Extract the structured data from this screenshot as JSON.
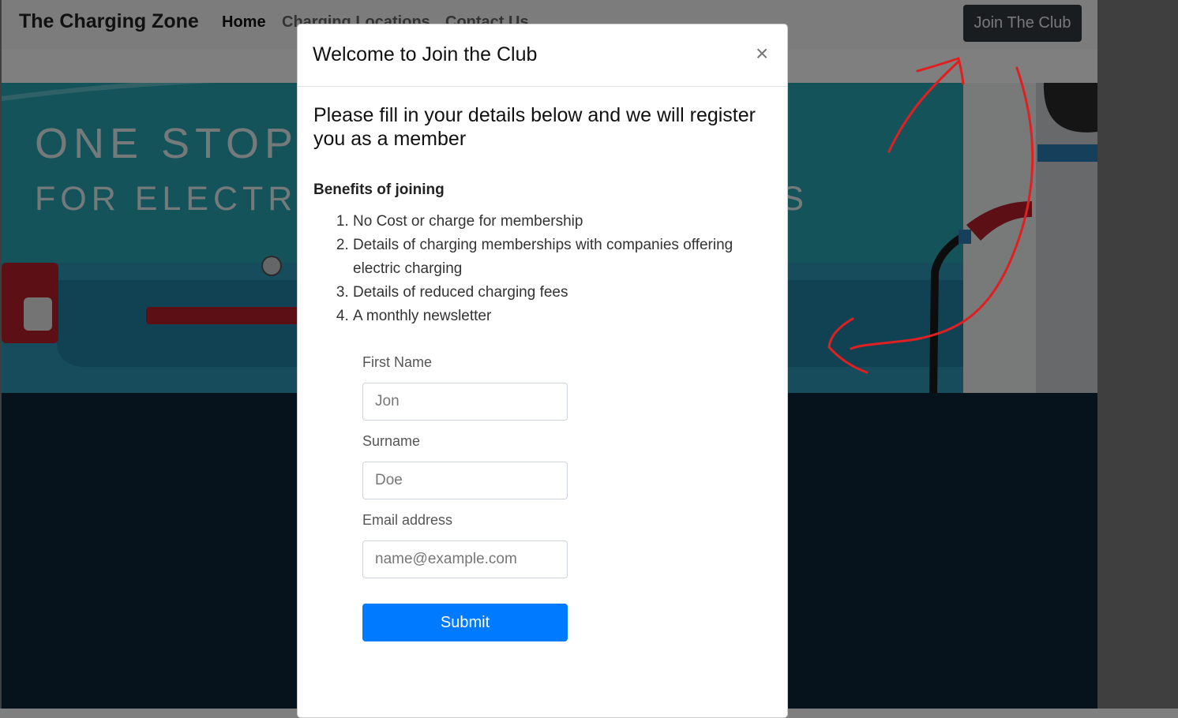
{
  "navbar": {
    "brand": "The Charging Zone",
    "links": [
      "Home",
      "Charging Locations",
      "Contact Us"
    ],
    "join_button": "Join The Club"
  },
  "hero": {
    "title_line1": "ONE STOP",
    "title_line2": "FOR ELECTR",
    "title_line2_tail": "DS"
  },
  "modal": {
    "title": "Welcome to Join the Club",
    "close_label": "×",
    "lead": "Please fill in your details below and we will register you as a member",
    "benefits_title": "Benefits of joining",
    "benefits": [
      "No Cost or charge for membership",
      "Details of charging memberships with companies offering electric charging",
      "Details of reduced charging fees",
      "A monthly newsletter"
    ],
    "form": {
      "first_name_label": "First Name",
      "first_name_placeholder": "Jon",
      "surname_label": "Surname",
      "surname_placeholder": "Doe",
      "email_label": "Email address",
      "email_placeholder": "name@example.com",
      "submit_label": "Submit"
    }
  },
  "colors": {
    "primary": "#007bff",
    "navbar_button": "#343a40",
    "annotation": "#e02020"
  }
}
